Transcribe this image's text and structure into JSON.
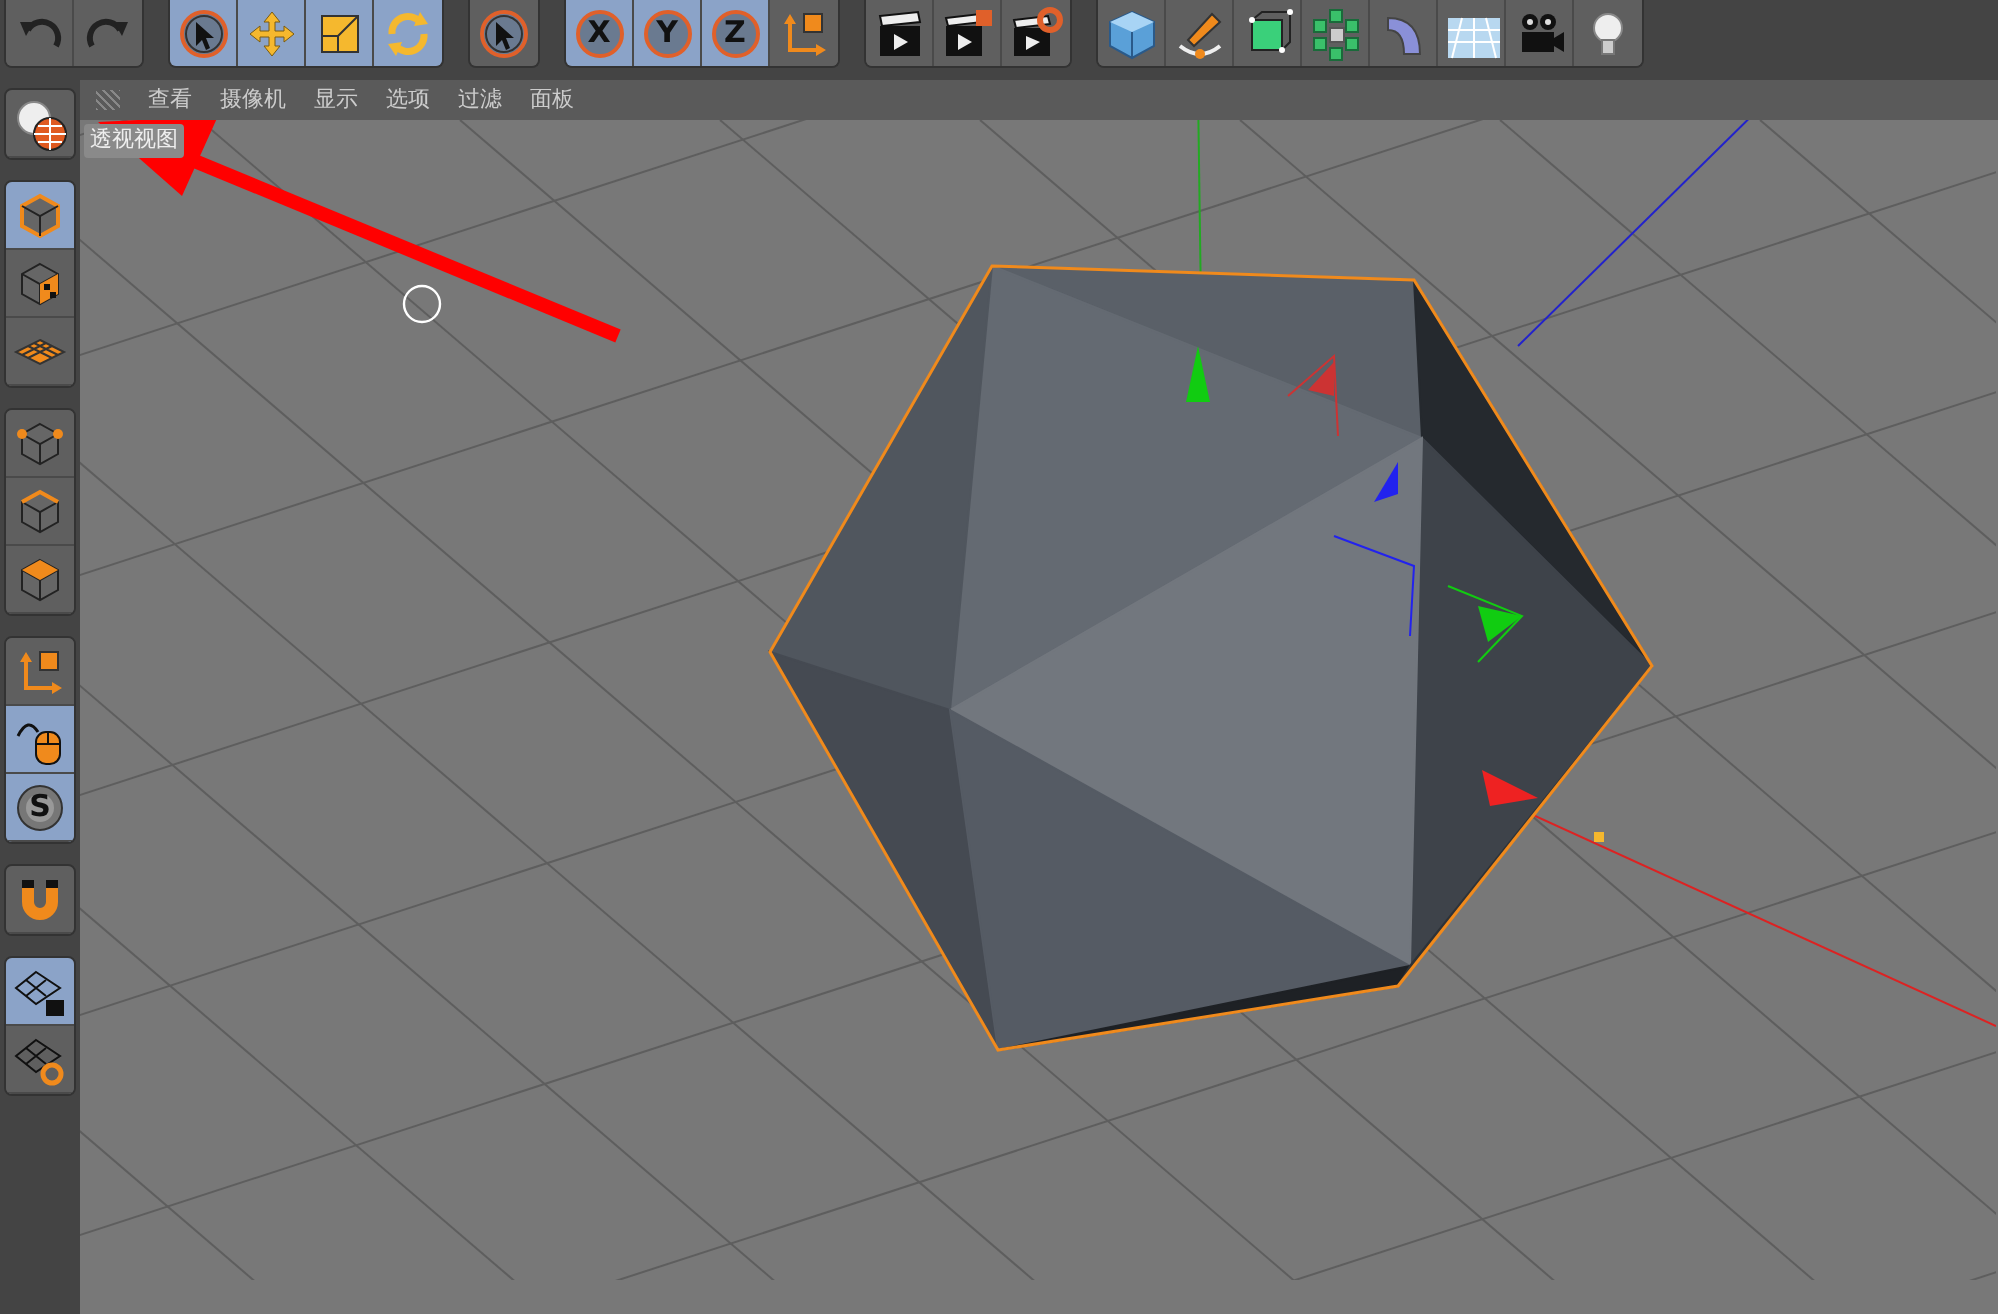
{
  "top_toolbar": [
    [
      {
        "kind": "undo",
        "selected": false
      },
      {
        "kind": "redo",
        "selected": false
      }
    ],
    [
      {
        "kind": "select",
        "selected": true
      },
      {
        "kind": "move",
        "selected": true
      },
      {
        "kind": "scale",
        "selected": true
      },
      {
        "kind": "rotate",
        "selected": true
      }
    ],
    [
      {
        "kind": "select",
        "selected": false
      }
    ],
    [
      {
        "kind": "axis_letter",
        "label": "X",
        "selected": true
      },
      {
        "kind": "axis_letter",
        "label": "Y",
        "selected": true
      },
      {
        "kind": "axis_letter",
        "label": "Z",
        "selected": true
      },
      {
        "kind": "coord",
        "selected": false
      }
    ],
    [
      {
        "kind": "render_view",
        "selected": false
      },
      {
        "kind": "render",
        "selected": false
      },
      {
        "kind": "render_settings",
        "selected": false
      }
    ],
    [
      {
        "kind": "cube",
        "selected": false
      },
      {
        "kind": "pen",
        "selected": false
      },
      {
        "kind": "subdivide",
        "selected": false
      },
      {
        "kind": "cloner",
        "selected": false
      },
      {
        "kind": "bend",
        "selected": false
      },
      {
        "kind": "floor",
        "selected": false
      },
      {
        "kind": "camera",
        "selected": false
      },
      {
        "kind": "light",
        "selected": false
      }
    ]
  ],
  "left_toolbar": [
    [
      {
        "kind": "view",
        "selected": false
      }
    ],
    [
      {
        "kind": "model",
        "selected": true
      },
      {
        "kind": "texture",
        "selected": false
      },
      {
        "kind": "workplane",
        "selected": false
      }
    ],
    [
      {
        "kind": "points",
        "selected": false
      },
      {
        "kind": "edges",
        "selected": false
      },
      {
        "kind": "polygons",
        "selected": false
      }
    ],
    [
      {
        "kind": "coord",
        "selected": false
      },
      {
        "kind": "tweak",
        "selected": true
      },
      {
        "kind": "snap",
        "label": "S",
        "selected": true
      }
    ],
    [
      {
        "kind": "magnet",
        "selected": false
      }
    ],
    [
      {
        "kind": "lock_grid",
        "selected": true
      },
      {
        "kind": "grid_rotate",
        "selected": false
      }
    ]
  ],
  "viewport_menu": [
    "查看",
    "摄像机",
    "显示",
    "选项",
    "过滤",
    "面板"
  ],
  "viewport": {
    "label": "透视视图"
  }
}
